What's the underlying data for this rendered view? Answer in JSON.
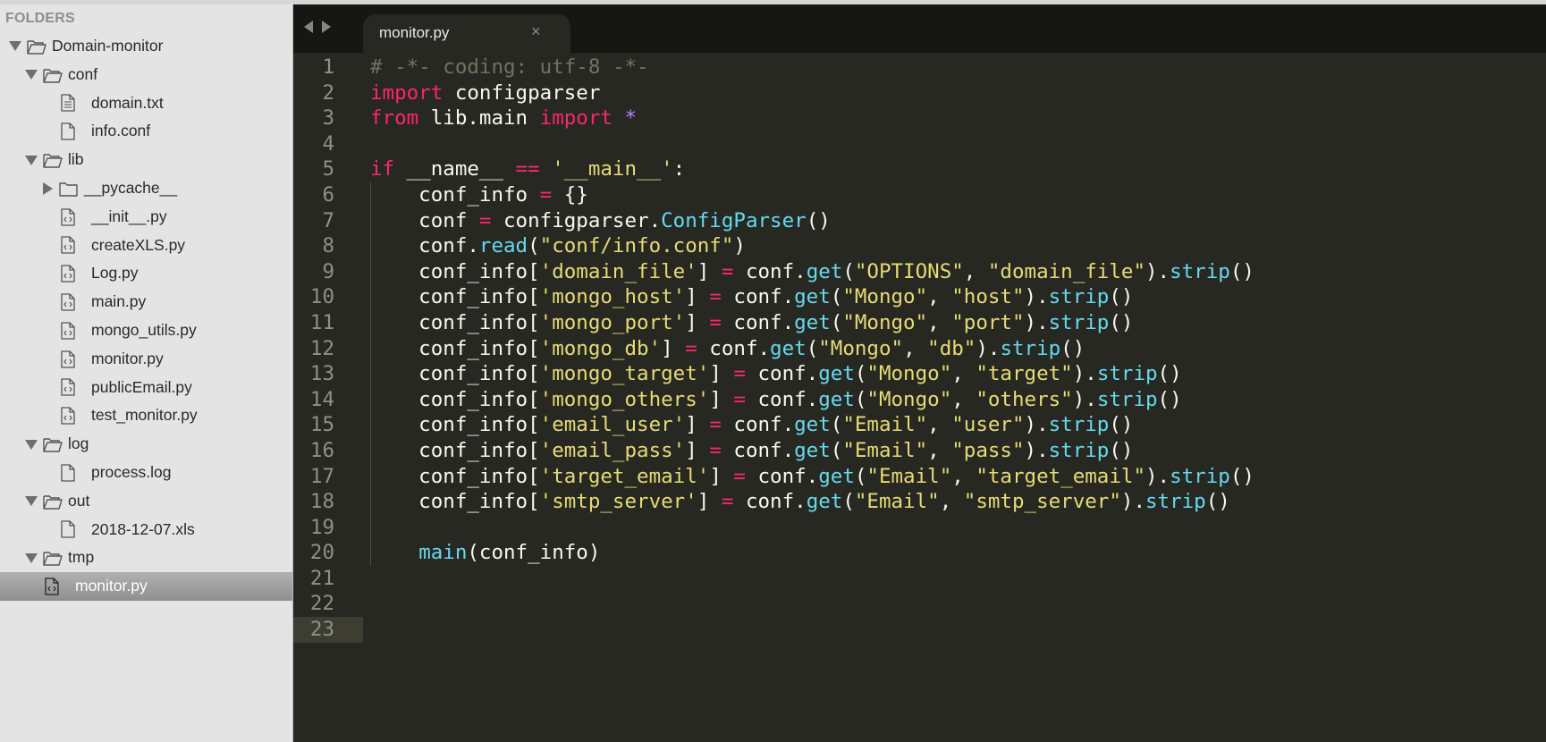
{
  "sidebar": {
    "header": "FOLDERS",
    "items": [
      {
        "label": "Domain-monitor",
        "kind": "folder",
        "state": "open",
        "depth": 0
      },
      {
        "label": "conf",
        "kind": "folder",
        "state": "open",
        "depth": 1
      },
      {
        "label": "domain.txt",
        "kind": "text-file",
        "depth": 2
      },
      {
        "label": "info.conf",
        "kind": "file",
        "depth": 2
      },
      {
        "label": "lib",
        "kind": "folder",
        "state": "open",
        "depth": 1
      },
      {
        "label": "__pycache__",
        "kind": "folder",
        "state": "closed",
        "depth": 2
      },
      {
        "label": "__init__.py",
        "kind": "code-file",
        "depth": 2
      },
      {
        "label": "createXLS.py",
        "kind": "code-file",
        "depth": 2
      },
      {
        "label": "Log.py",
        "kind": "code-file",
        "depth": 2
      },
      {
        "label": "main.py",
        "kind": "code-file",
        "depth": 2
      },
      {
        "label": "mongo_utils.py",
        "kind": "code-file",
        "depth": 2
      },
      {
        "label": "monitor.py",
        "kind": "code-file",
        "depth": 2
      },
      {
        "label": "publicEmail.py",
        "kind": "code-file",
        "depth": 2
      },
      {
        "label": "test_monitor.py",
        "kind": "code-file",
        "depth": 2
      },
      {
        "label": "log",
        "kind": "folder",
        "state": "open",
        "depth": 1
      },
      {
        "label": "process.log",
        "kind": "file",
        "depth": 2
      },
      {
        "label": "out",
        "kind": "folder",
        "state": "open",
        "depth": 1
      },
      {
        "label": "2018-12-07.xls",
        "kind": "file",
        "depth": 2
      },
      {
        "label": "tmp",
        "kind": "folder",
        "state": "open",
        "depth": 1
      },
      {
        "label": "monitor.py",
        "kind": "code-file",
        "depth": 1,
        "selected": true
      }
    ]
  },
  "editor": {
    "tab": {
      "label": "monitor.py",
      "close_glyph": "×"
    },
    "current_line": 23,
    "lines": [
      [
        [
          "com",
          "# -*- coding: utf-8 -*-"
        ]
      ],
      [
        [
          "kw",
          "import"
        ],
        [
          "pl",
          " configparser"
        ]
      ],
      [
        [
          "kw",
          "from"
        ],
        [
          "pl",
          " lib.main "
        ],
        [
          "kw",
          "import"
        ],
        [
          "pl",
          " "
        ],
        [
          "star",
          "*"
        ]
      ],
      [],
      [
        [
          "kw",
          "if"
        ],
        [
          "pl",
          " __name__ "
        ],
        [
          "op",
          "=="
        ],
        [
          "pl",
          " "
        ],
        [
          "str",
          "'__main__'"
        ],
        [
          "pl",
          ":"
        ]
      ],
      [
        [
          "pl",
          "    conf_info "
        ],
        [
          "op",
          "="
        ],
        [
          "pl",
          " {}"
        ]
      ],
      [
        [
          "pl",
          "    conf "
        ],
        [
          "op",
          "="
        ],
        [
          "pl",
          " configparser."
        ],
        [
          "fn",
          "ConfigParser"
        ],
        [
          "pl",
          "()"
        ]
      ],
      [
        [
          "pl",
          "    conf."
        ],
        [
          "fn",
          "read"
        ],
        [
          "pl",
          "("
        ],
        [
          "str",
          "\"conf/info.conf\""
        ],
        [
          "pl",
          ")"
        ]
      ],
      [
        [
          "pl",
          "    conf_info["
        ],
        [
          "str",
          "'domain_file'"
        ],
        [
          "pl",
          "] "
        ],
        [
          "op",
          "="
        ],
        [
          "pl",
          " conf."
        ],
        [
          "fn",
          "get"
        ],
        [
          "pl",
          "("
        ],
        [
          "str",
          "\"OPTIONS\""
        ],
        [
          "pl",
          ", "
        ],
        [
          "str",
          "\"domain_file\""
        ],
        [
          "pl",
          ")."
        ],
        [
          "fn",
          "strip"
        ],
        [
          "pl",
          "()"
        ]
      ],
      [
        [
          "pl",
          "    conf_info["
        ],
        [
          "str",
          "'mongo_host'"
        ],
        [
          "pl",
          "] "
        ],
        [
          "op",
          "="
        ],
        [
          "pl",
          " conf."
        ],
        [
          "fn",
          "get"
        ],
        [
          "pl",
          "("
        ],
        [
          "str",
          "\"Mongo\""
        ],
        [
          "pl",
          ", "
        ],
        [
          "str",
          "\"host\""
        ],
        [
          "pl",
          ")."
        ],
        [
          "fn",
          "strip"
        ],
        [
          "pl",
          "()"
        ]
      ],
      [
        [
          "pl",
          "    conf_info["
        ],
        [
          "str",
          "'mongo_port'"
        ],
        [
          "pl",
          "] "
        ],
        [
          "op",
          "="
        ],
        [
          "pl",
          " conf."
        ],
        [
          "fn",
          "get"
        ],
        [
          "pl",
          "("
        ],
        [
          "str",
          "\"Mongo\""
        ],
        [
          "pl",
          ", "
        ],
        [
          "str",
          "\"port\""
        ],
        [
          "pl",
          ")."
        ],
        [
          "fn",
          "strip"
        ],
        [
          "pl",
          "()"
        ]
      ],
      [
        [
          "pl",
          "    conf_info["
        ],
        [
          "str",
          "'mongo_db'"
        ],
        [
          "pl",
          "] "
        ],
        [
          "op",
          "="
        ],
        [
          "pl",
          " conf."
        ],
        [
          "fn",
          "get"
        ],
        [
          "pl",
          "("
        ],
        [
          "str",
          "\"Mongo\""
        ],
        [
          "pl",
          ", "
        ],
        [
          "str",
          "\"db\""
        ],
        [
          "pl",
          ")."
        ],
        [
          "fn",
          "strip"
        ],
        [
          "pl",
          "()"
        ]
      ],
      [
        [
          "pl",
          "    conf_info["
        ],
        [
          "str",
          "'mongo_target'"
        ],
        [
          "pl",
          "] "
        ],
        [
          "op",
          "="
        ],
        [
          "pl",
          " conf."
        ],
        [
          "fn",
          "get"
        ],
        [
          "pl",
          "("
        ],
        [
          "str",
          "\"Mongo\""
        ],
        [
          "pl",
          ", "
        ],
        [
          "str",
          "\"target\""
        ],
        [
          "pl",
          ")."
        ],
        [
          "fn",
          "strip"
        ],
        [
          "pl",
          "()"
        ]
      ],
      [
        [
          "pl",
          "    conf_info["
        ],
        [
          "str",
          "'mongo_others'"
        ],
        [
          "pl",
          "] "
        ],
        [
          "op",
          "="
        ],
        [
          "pl",
          " conf."
        ],
        [
          "fn",
          "get"
        ],
        [
          "pl",
          "("
        ],
        [
          "str",
          "\"Mongo\""
        ],
        [
          "pl",
          ", "
        ],
        [
          "str",
          "\"others\""
        ],
        [
          "pl",
          ")."
        ],
        [
          "fn",
          "strip"
        ],
        [
          "pl",
          "()"
        ]
      ],
      [
        [
          "pl",
          "    conf_info["
        ],
        [
          "str",
          "'email_user'"
        ],
        [
          "pl",
          "] "
        ],
        [
          "op",
          "="
        ],
        [
          "pl",
          " conf."
        ],
        [
          "fn",
          "get"
        ],
        [
          "pl",
          "("
        ],
        [
          "str",
          "\"Email\""
        ],
        [
          "pl",
          ", "
        ],
        [
          "str",
          "\"user\""
        ],
        [
          "pl",
          ")."
        ],
        [
          "fn",
          "strip"
        ],
        [
          "pl",
          "()"
        ]
      ],
      [
        [
          "pl",
          "    conf_info["
        ],
        [
          "str",
          "'email_pass'"
        ],
        [
          "pl",
          "] "
        ],
        [
          "op",
          "="
        ],
        [
          "pl",
          " conf."
        ],
        [
          "fn",
          "get"
        ],
        [
          "pl",
          "("
        ],
        [
          "str",
          "\"Email\""
        ],
        [
          "pl",
          ", "
        ],
        [
          "str",
          "\"pass\""
        ],
        [
          "pl",
          ")."
        ],
        [
          "fn",
          "strip"
        ],
        [
          "pl",
          "()"
        ]
      ],
      [
        [
          "pl",
          "    conf_info["
        ],
        [
          "str",
          "'target_email'"
        ],
        [
          "pl",
          "] "
        ],
        [
          "op",
          "="
        ],
        [
          "pl",
          " conf."
        ],
        [
          "fn",
          "get"
        ],
        [
          "pl",
          "("
        ],
        [
          "str",
          "\"Email\""
        ],
        [
          "pl",
          ", "
        ],
        [
          "str",
          "\"target_email\""
        ],
        [
          "pl",
          ")."
        ],
        [
          "fn",
          "strip"
        ],
        [
          "pl",
          "()"
        ]
      ],
      [
        [
          "pl",
          "    conf_info["
        ],
        [
          "str",
          "'smtp_server'"
        ],
        [
          "pl",
          "] "
        ],
        [
          "op",
          "="
        ],
        [
          "pl",
          " conf."
        ],
        [
          "fn",
          "get"
        ],
        [
          "pl",
          "("
        ],
        [
          "str",
          "\"Email\""
        ],
        [
          "pl",
          ", "
        ],
        [
          "str",
          "\"smtp_server\""
        ],
        [
          "pl",
          ")."
        ],
        [
          "fn",
          "strip"
        ],
        [
          "pl",
          "()"
        ]
      ],
      [],
      [
        [
          "pl",
          "    "
        ],
        [
          "fn",
          "main"
        ],
        [
          "pl",
          "(conf_info)"
        ]
      ],
      [],
      [],
      []
    ]
  },
  "colors": {
    "sidebar_bg": "#e4e4e4",
    "editor_bg": "#272822",
    "keyword": "#f92672",
    "string": "#e6db74",
    "function": "#66d9ef",
    "comment": "#75715e",
    "constant": "#ae81ff"
  }
}
